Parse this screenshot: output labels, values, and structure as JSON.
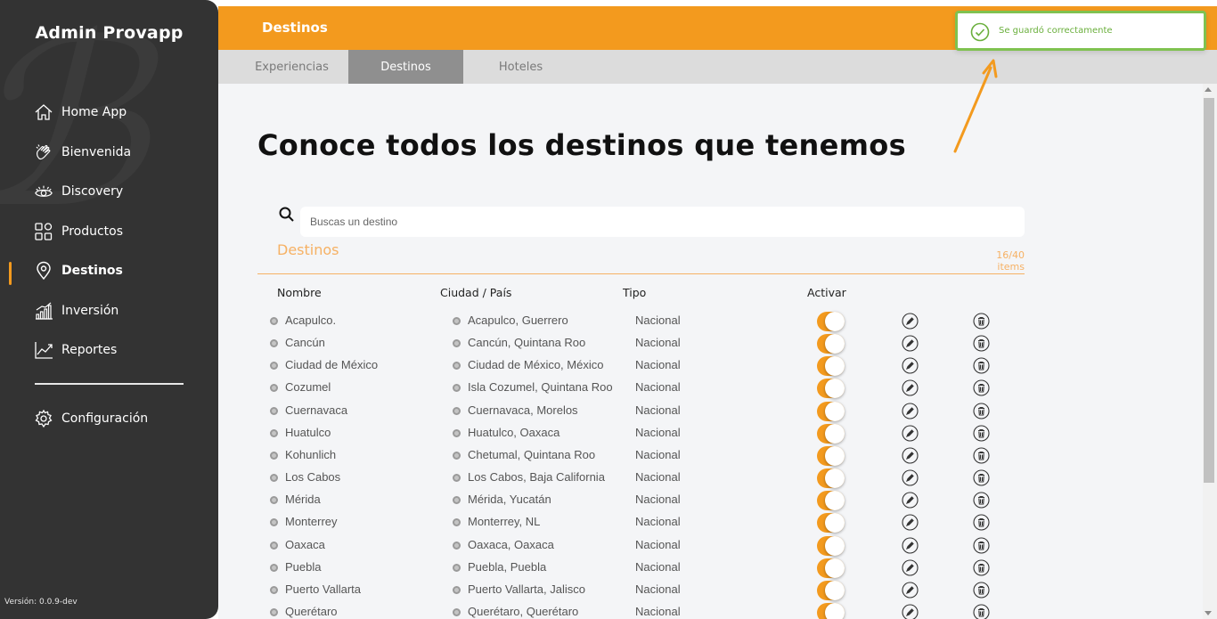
{
  "app": {
    "title": "Admin Provapp",
    "version": "Versión: 0.0.9-dev"
  },
  "sidebar": {
    "items": [
      {
        "label": "Home App",
        "icon": "home-icon"
      },
      {
        "label": "Bienvenida",
        "icon": "waving-hand-icon"
      },
      {
        "label": "Discovery",
        "icon": "eye-icon"
      },
      {
        "label": "Productos",
        "icon": "products-grid-icon"
      },
      {
        "label": "Destinos",
        "icon": "location-pin-icon",
        "active": true
      },
      {
        "label": "Inversión",
        "icon": "bar-chart-icon"
      },
      {
        "label": "Reportes",
        "icon": "line-chart-icon"
      }
    ],
    "settings": {
      "label": "Configuración",
      "icon": "gear-icon"
    }
  },
  "header": {
    "title": "Destinos"
  },
  "tabs": [
    {
      "label": "Experiencias"
    },
    {
      "label": "Destinos",
      "active": true
    },
    {
      "label": "Hoteles"
    }
  ],
  "page": {
    "title": "Conoce todos los destinos que tenemos",
    "search_placeholder": "Buscas un destino",
    "section_label": "Destinos",
    "items_count": "16/40 items"
  },
  "table": {
    "headers": {
      "name": "Nombre",
      "city": "Ciudad / País",
      "type": "Tipo",
      "active": "Activar"
    },
    "rows": [
      {
        "name": "Acapulco.",
        "city": "Acapulco, Guerrero",
        "type": "Nacional",
        "active": true
      },
      {
        "name": "Cancún",
        "city": "Cancún, Quintana Roo",
        "type": "Nacional",
        "active": true
      },
      {
        "name": "Ciudad de México",
        "city": "Ciudad de México, México",
        "type": "Nacional",
        "active": true
      },
      {
        "name": "Cozumel",
        "city": "Isla Cozumel, Quintana Roo",
        "type": "Nacional",
        "active": true
      },
      {
        "name": "Cuernavaca",
        "city": "Cuernavaca, Morelos",
        "type": "Nacional",
        "active": true
      },
      {
        "name": "Huatulco",
        "city": "Huatulco, Oaxaca",
        "type": "Nacional",
        "active": true
      },
      {
        "name": "Kohunlich",
        "city": "Chetumal, Quintana Roo",
        "type": "Nacional",
        "active": true
      },
      {
        "name": "Los Cabos",
        "city": "Los Cabos, Baja California",
        "type": "Nacional",
        "active": true
      },
      {
        "name": "Mérida",
        "city": "Mérida, Yucatán",
        "type": "Nacional",
        "active": true
      },
      {
        "name": "Monterrey",
        "city": "Monterrey, NL",
        "type": "Nacional",
        "active": true
      },
      {
        "name": "Oaxaca",
        "city": "Oaxaca, Oaxaca",
        "type": "Nacional",
        "active": true
      },
      {
        "name": "Puebla",
        "city": "Puebla, Puebla",
        "type": "Nacional",
        "active": true
      },
      {
        "name": "Puerto Vallarta",
        "city": "Puerto Vallarta, Jalisco",
        "type": "Nacional",
        "active": true
      },
      {
        "name": "Querétaro",
        "city": "Querétaro, Querétaro",
        "type": "Nacional",
        "active": true
      }
    ]
  },
  "toast": {
    "message": "Se guardó correctamente",
    "icon": "check-circle-icon"
  },
  "colors": {
    "accent": "#f39a1e",
    "sidebar": "#333333",
    "success": "#7fc250"
  }
}
